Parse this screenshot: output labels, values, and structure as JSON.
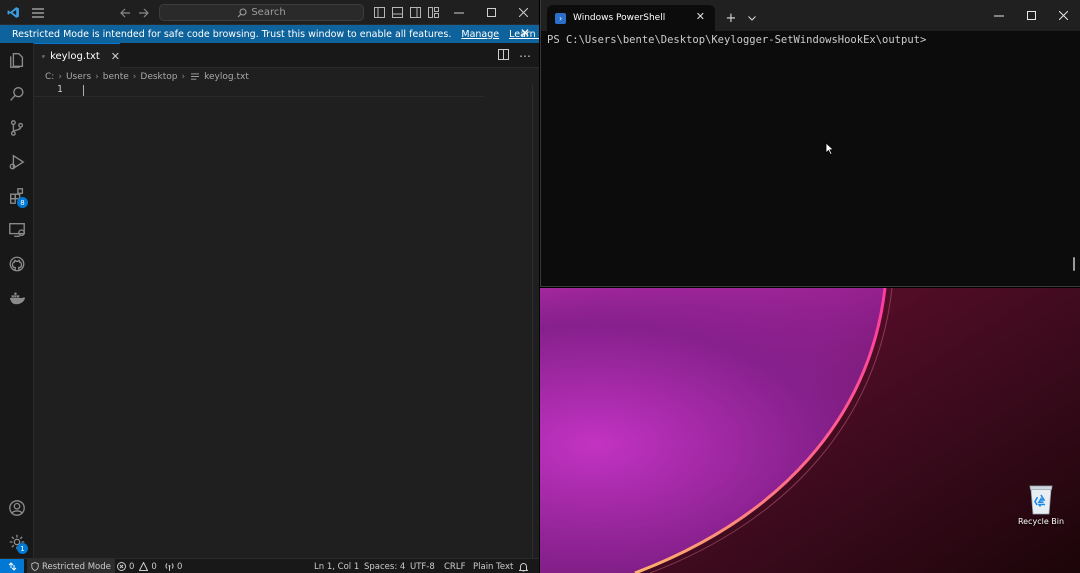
{
  "vscode": {
    "search_placeholder": "Search",
    "banner": {
      "text": "Restricted Mode is intended for safe code browsing. Trust this window to enable all features.",
      "manage": "Manage",
      "learn_more": "Learn More"
    },
    "tab": {
      "label": "keylog.txt"
    },
    "breadcrumb": {
      "items": [
        "C:",
        "Users",
        "bente",
        "Desktop",
        "keylog.txt"
      ]
    },
    "editor": {
      "line_number": "1"
    },
    "activity_badges": {
      "extensions": "8",
      "settings": "1"
    },
    "status": {
      "restricted": "Restricted Mode",
      "errors": "0",
      "warnings": "0",
      "ports": "0",
      "position": "Ln 1, Col 1",
      "spaces": "Spaces: 4",
      "encoding": "UTF-8",
      "eol": "CRLF",
      "language": "Plain Text"
    },
    "accent": "#0078d4"
  },
  "terminal": {
    "tab_title": "Windows PowerShell",
    "prompt": "PS C:\\Users\\bente\\Desktop\\Keylogger-SetWindowsHookEx\\output>"
  },
  "desktop": {
    "recycle_bin_label": "Recycle Bin"
  }
}
